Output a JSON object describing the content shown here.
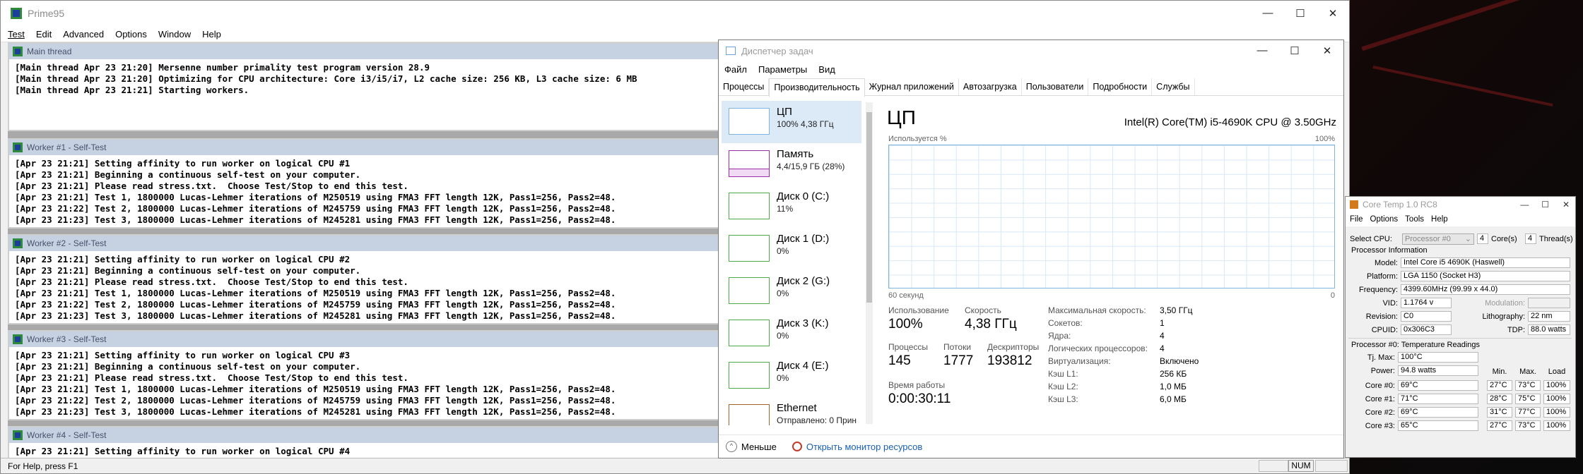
{
  "prime95": {
    "title": "Prime95",
    "window_controls": {
      "minimize": "—",
      "maximize": "☐",
      "close": "✕"
    },
    "menu": [
      "Test",
      "Edit",
      "Advanced",
      "Options",
      "Window",
      "Help"
    ],
    "windows": [
      {
        "title": "Main thread",
        "lines": [
          "[Main thread Apr 23 21:20] Mersenne number primality test program version 28.9",
          "[Main thread Apr 23 21:20] Optimizing for CPU architecture: Core i3/i5/i7, L2 cache size: 256 KB, L3 cache size: 6 MB",
          "[Main thread Apr 23 21:21] Starting workers."
        ]
      },
      {
        "title": "Worker #1 - Self-Test",
        "lines": [
          "[Apr 23 21:21] Setting affinity to run worker on logical CPU #1",
          "[Apr 23 21:21] Beginning a continuous self-test on your computer.",
          "[Apr 23 21:21] Please read stress.txt.  Choose Test/Stop to end this test.",
          "[Apr 23 21:21] Test 1, 1800000 Lucas-Lehmer iterations of M250519 using FMA3 FFT length 12K, Pass1=256, Pass2=48.",
          "[Apr 23 21:22] Test 2, 1800000 Lucas-Lehmer iterations of M245759 using FMA3 FFT length 12K, Pass1=256, Pass2=48.",
          "[Apr 23 21:23] Test 3, 1800000 Lucas-Lehmer iterations of M245281 using FMA3 FFT length 12K, Pass1=256, Pass2=48."
        ]
      },
      {
        "title": "Worker #2 - Self-Test",
        "lines": [
          "[Apr 23 21:21] Setting affinity to run worker on logical CPU #2",
          "[Apr 23 21:21] Beginning a continuous self-test on your computer.",
          "[Apr 23 21:21] Please read stress.txt.  Choose Test/Stop to end this test.",
          "[Apr 23 21:21] Test 1, 1800000 Lucas-Lehmer iterations of M250519 using FMA3 FFT length 12K, Pass1=256, Pass2=48.",
          "[Apr 23 21:22] Test 2, 1800000 Lucas-Lehmer iterations of M245759 using FMA3 FFT length 12K, Pass1=256, Pass2=48.",
          "[Apr 23 21:23] Test 3, 1800000 Lucas-Lehmer iterations of M245281 using FMA3 FFT length 12K, Pass1=256, Pass2=48."
        ]
      },
      {
        "title": "Worker #3 - Self-Test",
        "lines": [
          "[Apr 23 21:21] Setting affinity to run worker on logical CPU #3",
          "[Apr 23 21:21] Beginning a continuous self-test on your computer.",
          "[Apr 23 21:21] Please read stress.txt.  Choose Test/Stop to end this test.",
          "[Apr 23 21:21] Test 1, 1800000 Lucas-Lehmer iterations of M250519 using FMA3 FFT length 12K, Pass1=256, Pass2=48.",
          "[Apr 23 21:22] Test 2, 1800000 Lucas-Lehmer iterations of M245759 using FMA3 FFT length 12K, Pass1=256, Pass2=48.",
          "[Apr 23 21:23] Test 3, 1800000 Lucas-Lehmer iterations of M245281 using FMA3 FFT length 12K, Pass1=256, Pass2=48."
        ]
      },
      {
        "title": "Worker #4 - Self-Test",
        "lines": [
          "[Apr 23 21:21] Setting affinity to run worker on logical CPU #4"
        ]
      }
    ],
    "status_text": "For Help, press F1",
    "status_num": "NUM"
  },
  "taskmgr": {
    "title": "Диспетчер задач",
    "menu": [
      "Файл",
      "Параметры",
      "Вид"
    ],
    "tabs": [
      "Процессы",
      "Производительность",
      "Журнал приложений",
      "Автозагрузка",
      "Пользователи",
      "Подробности",
      "Службы"
    ],
    "active_tab": 1,
    "sidebar": [
      {
        "name": "ЦП",
        "value": "100% 4,38 ГГц",
        "kind": "cpu"
      },
      {
        "name": "Память",
        "value": "4,4/15,9 ГБ (28%)",
        "kind": "mem"
      },
      {
        "name": "Диск 0 (C:)",
        "value": "11%",
        "kind": "disk"
      },
      {
        "name": "Диск 1 (D:)",
        "value": "0%",
        "kind": "disk"
      },
      {
        "name": "Диск 2 (G:)",
        "value": "0%",
        "kind": "disk"
      },
      {
        "name": "Диск 3 (K:)",
        "value": "0%",
        "kind": "disk"
      },
      {
        "name": "Диск 4 (E:)",
        "value": "0%",
        "kind": "disk"
      },
      {
        "name": "Ethernet",
        "value": "Отправлено: 0 Прин",
        "kind": "eth"
      }
    ],
    "heading": "ЦП",
    "cpu_name": "Intel(R) Core(TM) i5-4690K CPU @ 3.50GHz",
    "graph": {
      "label": "Используется %",
      "max": "100%",
      "time": "60 секунд",
      "min": "0",
      "utilization": 100
    },
    "stats": {
      "util_label": "Использование",
      "util": "100%",
      "speed_label": "Скорость",
      "speed": "4,38 ГГц",
      "proc_label": "Процессы",
      "proc": "145",
      "threads_label": "Потоки",
      "threads": "1777",
      "handles_label": "Дескрипторы",
      "handles": "193812",
      "uptime_label": "Время работы",
      "uptime": "0:00:30:11"
    },
    "specs": [
      {
        "k": "Максимальная скорость:",
        "v": "3,50 ГГц"
      },
      {
        "k": "Сокетов:",
        "v": "1"
      },
      {
        "k": "Ядра:",
        "v": "4"
      },
      {
        "k": "Логических процессоров:",
        "v": "4"
      },
      {
        "k": "Виртуализация:",
        "v": "Включено"
      },
      {
        "k": "Кэш L1:",
        "v": "256 КБ"
      },
      {
        "k": "Кэш L2:",
        "v": "1,0 МБ"
      },
      {
        "k": "Кэш L3:",
        "v": "6,0 МБ"
      }
    ],
    "footer": {
      "less": "Меньше",
      "monitor": "Открыть монитор ресурсов"
    }
  },
  "coretemp": {
    "title": "Core Temp 1.0 RC8",
    "menu": [
      "File",
      "Options",
      "Tools",
      "Help"
    ],
    "select_cpu_label": "Select CPU:",
    "select_cpu": "Processor #0",
    "cores_count": "4",
    "cores_label": "Core(s)",
    "threads_count": "4",
    "threads_label": "Thread(s)",
    "info_title": "Processor Information",
    "model_label": "Model:",
    "model": "Intel Core i5 4690K (Haswell)",
    "platform_label": "Platform:",
    "platform": "LGA 1150 (Socket H3)",
    "freq_label": "Frequency:",
    "freq": "4399.60MHz (99.99 x 44.0)",
    "vid_label": "VID:",
    "vid": "1.1764 v",
    "modulation_label": "Modulation:",
    "revision_label": "Revision:",
    "revision": "C0",
    "litho_label": "Lithography:",
    "litho": "22 nm",
    "cpuid_label": "CPUID:",
    "cpuid": "0x306C3",
    "tdp_label": "TDP:",
    "tdp": "88.0 watts",
    "temp_title": "Processor #0: Temperature Readings",
    "tjmax_label": "Tj. Max:",
    "tjmax": "100°C",
    "power_label": "Power:",
    "power": "94.8 watts",
    "col_min": "Min.",
    "col_max": "Max.",
    "col_load": "Load",
    "cores": [
      {
        "label": "Core #0:",
        "temp": "69°C",
        "min": "27°C",
        "max": "73°C",
        "load": "100%"
      },
      {
        "label": "Core #1:",
        "temp": "71°C",
        "min": "28°C",
        "max": "75°C",
        "load": "100%"
      },
      {
        "label": "Core #2:",
        "temp": "69°C",
        "min": "31°C",
        "max": "77°C",
        "load": "100%"
      },
      {
        "label": "Core #3:",
        "temp": "65°C",
        "min": "27°C",
        "max": "73°C",
        "load": "100%"
      }
    ]
  }
}
